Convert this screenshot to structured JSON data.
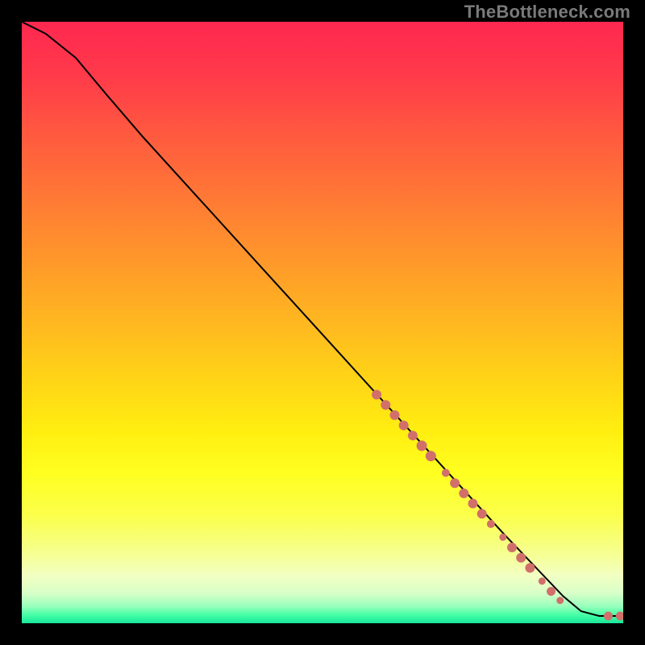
{
  "watermark": "TheBottleneck.com",
  "colors": {
    "dot": "#d1706b",
    "line": "#000000",
    "gradient_stops": [
      {
        "offset": 0.0,
        "color": "#ff2850"
      },
      {
        "offset": 0.09,
        "color": "#ff3a4a"
      },
      {
        "offset": 0.18,
        "color": "#ff5740"
      },
      {
        "offset": 0.28,
        "color": "#ff7536"
      },
      {
        "offset": 0.38,
        "color": "#ff932c"
      },
      {
        "offset": 0.48,
        "color": "#ffb122"
      },
      {
        "offset": 0.58,
        "color": "#ffd018"
      },
      {
        "offset": 0.68,
        "color": "#ffee10"
      },
      {
        "offset": 0.75,
        "color": "#ffff20"
      },
      {
        "offset": 0.82,
        "color": "#fbff4a"
      },
      {
        "offset": 0.88,
        "color": "#f6ff8c"
      },
      {
        "offset": 0.92,
        "color": "#f3ffc2"
      },
      {
        "offset": 0.95,
        "color": "#d8ffc8"
      },
      {
        "offset": 0.972,
        "color": "#97ffbc"
      },
      {
        "offset": 0.986,
        "color": "#46ffa6"
      },
      {
        "offset": 1.0,
        "color": "#18e69a"
      }
    ]
  },
  "chart_data": {
    "type": "line",
    "title": "",
    "xlabel": "",
    "ylabel": "",
    "xlim": [
      0,
      100
    ],
    "ylim": [
      0,
      100
    ],
    "curve": [
      {
        "x": 0,
        "y": 100
      },
      {
        "x": 4,
        "y": 98
      },
      {
        "x": 9,
        "y": 94
      },
      {
        "x": 14,
        "y": 88
      },
      {
        "x": 20,
        "y": 81
      },
      {
        "x": 30,
        "y": 70
      },
      {
        "x": 40,
        "y": 59
      },
      {
        "x": 50,
        "y": 48
      },
      {
        "x": 60,
        "y": 37
      },
      {
        "x": 70,
        "y": 26
      },
      {
        "x": 80,
        "y": 15
      },
      {
        "x": 90,
        "y": 4.5
      },
      {
        "x": 93,
        "y": 2.0
      },
      {
        "x": 96,
        "y": 1.2
      },
      {
        "x": 100,
        "y": 1.2
      }
    ],
    "dots": [
      {
        "x": 59.0,
        "y": 38.0,
        "r": 6
      },
      {
        "x": 60.5,
        "y": 36.3,
        "r": 6
      },
      {
        "x": 62.0,
        "y": 34.6,
        "r": 6
      },
      {
        "x": 63.5,
        "y": 32.9,
        "r": 6
      },
      {
        "x": 65.0,
        "y": 31.2,
        "r": 6
      },
      {
        "x": 66.5,
        "y": 29.5,
        "r": 6.5
      },
      {
        "x": 68.0,
        "y": 27.8,
        "r": 6.5
      },
      {
        "x": 70.5,
        "y": 25.0,
        "r": 5
      },
      {
        "x": 72.0,
        "y": 23.3,
        "r": 6
      },
      {
        "x": 73.5,
        "y": 21.6,
        "r": 6
      },
      {
        "x": 75.0,
        "y": 19.9,
        "r": 6
      },
      {
        "x": 76.5,
        "y": 18.2,
        "r": 6
      },
      {
        "x": 78.0,
        "y": 16.5,
        "r": 5
      },
      {
        "x": 80.0,
        "y": 14.3,
        "r": 4.5
      },
      {
        "x": 81.5,
        "y": 12.6,
        "r": 6
      },
      {
        "x": 83.0,
        "y": 10.9,
        "r": 6
      },
      {
        "x": 84.5,
        "y": 9.2,
        "r": 6
      },
      {
        "x": 86.5,
        "y": 7.0,
        "r": 4.5
      },
      {
        "x": 88.0,
        "y": 5.3,
        "r": 5.5
      },
      {
        "x": 89.5,
        "y": 3.8,
        "r": 4.5
      },
      {
        "x": 97.5,
        "y": 1.2,
        "r": 5.5
      },
      {
        "x": 99.5,
        "y": 1.2,
        "r": 5.5
      }
    ]
  }
}
